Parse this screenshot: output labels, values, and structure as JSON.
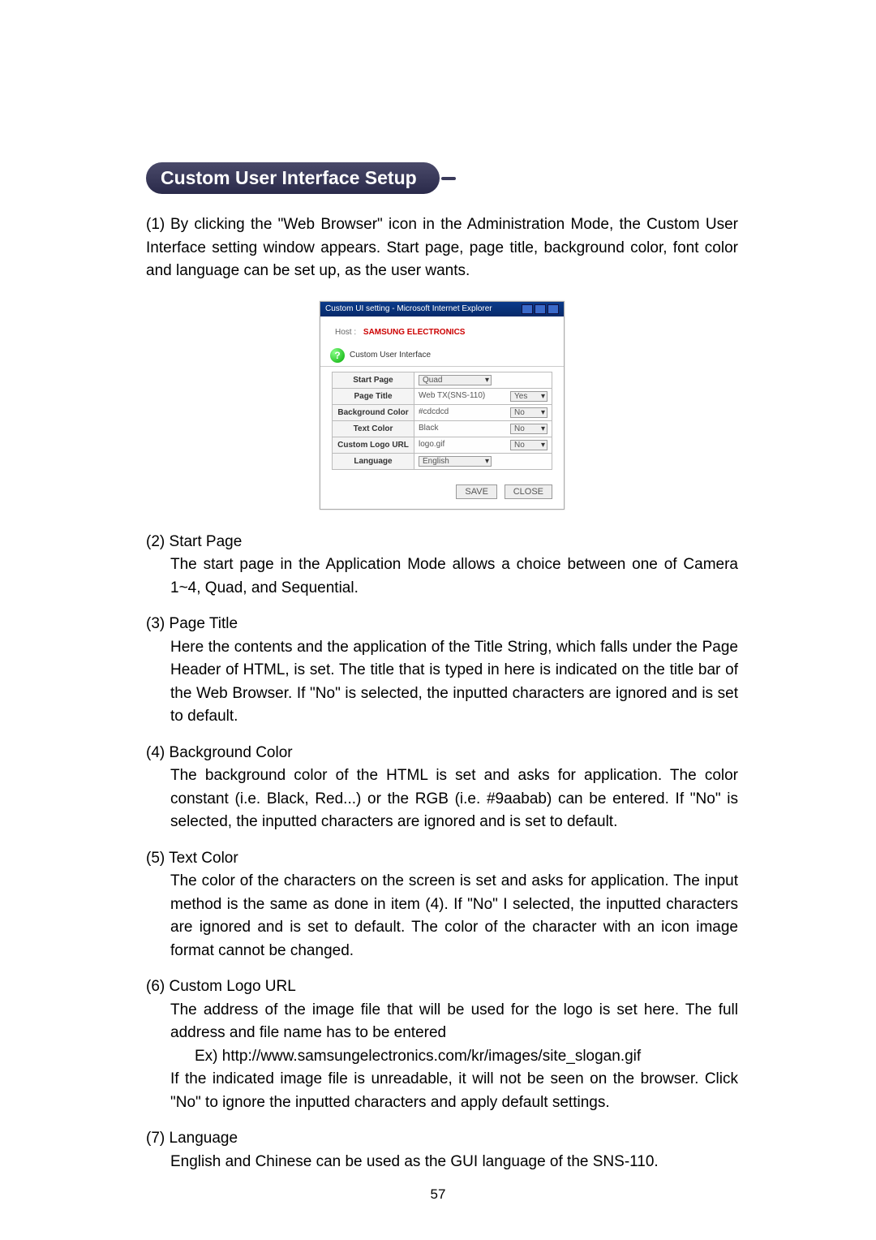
{
  "heading": "Custom User Interface Setup",
  "intro_num": "(1)",
  "intro": "By clicking the \"Web Browser\" icon in the Administration Mode, the Custom User Interface setting window appears. Start page, page title, background color, font color and language can be set up, as the user wants.",
  "figure": {
    "win_title": "Custom UI setting - Microsoft Internet Explorer",
    "host_label": "Host :",
    "brand": "SAMSUNG ELECTRONICS",
    "section": "Custom User Interface",
    "rows": {
      "start_page": {
        "label": "Start Page",
        "value": "Quad"
      },
      "page_title": {
        "label": "Page Title",
        "value": "Web TX(SNS-110)",
        "opt": "Yes"
      },
      "bg_color": {
        "label": "Background Color",
        "value": "#cdcdcd",
        "opt": "No"
      },
      "text_color": {
        "label": "Text Color",
        "value": "Black",
        "opt": "No"
      },
      "logo_url": {
        "label": "Custom Logo URL",
        "value": "logo.gif",
        "opt": "No"
      },
      "language": {
        "label": "Language",
        "value": "English"
      }
    },
    "btn_save": "SAVE",
    "btn_close": "CLOSE"
  },
  "items": [
    {
      "num": "(2)",
      "title": "Start Page",
      "body": "The start page in the Application Mode allows a choice between one of Camera 1~4, Quad, and Sequential."
    },
    {
      "num": "(3)",
      "title": "Page Title",
      "body": "Here the contents and the application of the Title String, which falls under the Page Header of HTML, is set. The title that is typed in here is indicated on the title bar of the Web Browser. If \"No\" is selected, the inputted characters are ignored and is set to default."
    },
    {
      "num": "(4)",
      "title": "Background Color",
      "body": "The background color of the HTML is set and asks for application. The color constant (i.e. Black, Red...) or the RGB (i.e. #9aabab) can be entered. If \"No\" is selected, the inputted characters are ignored and is set to default."
    },
    {
      "num": "(5)",
      "title": "Text Color",
      "body": "The color of the characters on the screen is set and asks for application. The input method is the same as done in item (4). If \"No\" I selected, the inputted characters are ignored and is set to default. The color of the character with an icon image format cannot be changed."
    },
    {
      "num": "(6)",
      "title": "Custom Logo URL",
      "body": "The address of the image file that will be used for the logo is set here. The full address and file name has to be entered",
      "ex": "Ex) http://www.samsungelectronics.com/kr/images/site_slogan.gif",
      "body2": "If the indicated image file is unreadable, it will not be seen on the browser. Click \"No\" to ignore the inputted characters and apply default settings."
    },
    {
      "num": "(7)",
      "title": "Language",
      "body": "English and Chinese can be used as the GUI language of the SNS-110."
    }
  ],
  "page_number": "57"
}
